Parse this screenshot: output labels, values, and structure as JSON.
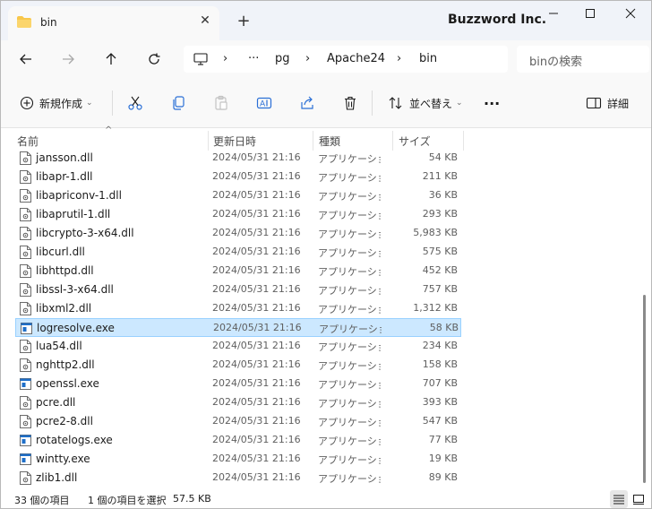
{
  "window": {
    "tab_title": "bin",
    "brand": "Buzzword Inc.",
    "tab_close_icon": "close-icon",
    "new_tab_icon": "plus-icon"
  },
  "nav": {
    "breadcrumb": [
      "pg",
      "Apache24",
      "bin"
    ],
    "ellipsis": "···",
    "search_placeholder": "binの検索"
  },
  "toolbar": {
    "new_label": "新規作成",
    "sort_label": "並べ替え",
    "more_label": "···",
    "details_label": "詳細"
  },
  "columns": {
    "name": "名前",
    "date": "更新日時",
    "type": "種類",
    "size": "サイズ"
  },
  "files": [
    {
      "name": "jansson.dll",
      "date": "2024/05/31 21:16",
      "type": "アプリケーショ...",
      "size": "54 KB",
      "kind": "dll"
    },
    {
      "name": "libapr-1.dll",
      "date": "2024/05/31 21:16",
      "type": "アプリケーショ...",
      "size": "211 KB",
      "kind": "dll"
    },
    {
      "name": "libapriconv-1.dll",
      "date": "2024/05/31 21:16",
      "type": "アプリケーショ...",
      "size": "36 KB",
      "kind": "dll"
    },
    {
      "name": "libaprutil-1.dll",
      "date": "2024/05/31 21:16",
      "type": "アプリケーショ...",
      "size": "293 KB",
      "kind": "dll"
    },
    {
      "name": "libcrypto-3-x64.dll",
      "date": "2024/05/31 21:16",
      "type": "アプリケーショ...",
      "size": "5,983 KB",
      "kind": "dll"
    },
    {
      "name": "libcurl.dll",
      "date": "2024/05/31 21:16",
      "type": "アプリケーショ...",
      "size": "575 KB",
      "kind": "dll"
    },
    {
      "name": "libhttpd.dll",
      "date": "2024/05/31 21:16",
      "type": "アプリケーショ...",
      "size": "452 KB",
      "kind": "dll"
    },
    {
      "name": "libssl-3-x64.dll",
      "date": "2024/05/31 21:16",
      "type": "アプリケーショ...",
      "size": "757 KB",
      "kind": "dll"
    },
    {
      "name": "libxml2.dll",
      "date": "2024/05/31 21:16",
      "type": "アプリケーショ...",
      "size": "1,312 KB",
      "kind": "dll"
    },
    {
      "name": "logresolve.exe",
      "date": "2024/05/31 21:16",
      "type": "アプリケーション",
      "size": "58 KB",
      "kind": "exe"
    },
    {
      "name": "lua54.dll",
      "date": "2024/05/31 21:16",
      "type": "アプリケーショ...",
      "size": "234 KB",
      "kind": "dll"
    },
    {
      "name": "nghttp2.dll",
      "date": "2024/05/31 21:16",
      "type": "アプリケーショ...",
      "size": "158 KB",
      "kind": "dll"
    },
    {
      "name": "openssl.exe",
      "date": "2024/05/31 21:16",
      "type": "アプリケーション",
      "size": "707 KB",
      "kind": "exe"
    },
    {
      "name": "pcre.dll",
      "date": "2024/05/31 21:16",
      "type": "アプリケーショ...",
      "size": "393 KB",
      "kind": "dll"
    },
    {
      "name": "pcre2-8.dll",
      "date": "2024/05/31 21:16",
      "type": "アプリケーショ...",
      "size": "547 KB",
      "kind": "dll"
    },
    {
      "name": "rotatelogs.exe",
      "date": "2024/05/31 21:16",
      "type": "アプリケーション",
      "size": "77 KB",
      "kind": "exe"
    },
    {
      "name": "wintty.exe",
      "date": "2024/05/31 21:16",
      "type": "アプリケーション",
      "size": "19 KB",
      "kind": "exe"
    },
    {
      "name": "zlib1.dll",
      "date": "2024/05/31 21:16",
      "type": "アプリケーショ...",
      "size": "89 KB",
      "kind": "dll"
    }
  ],
  "selected_file": "logresolve.exe",
  "status": {
    "item_count": "33 個の項目",
    "selection": "1 個の項目を選択",
    "selection_size": "57.5 KB"
  },
  "colors": {
    "selection_bg": "#cce8ff",
    "selection_border": "#99d1ff",
    "folder_yellow": "#f8c74a",
    "exe_blue": "#1f6fc8"
  }
}
